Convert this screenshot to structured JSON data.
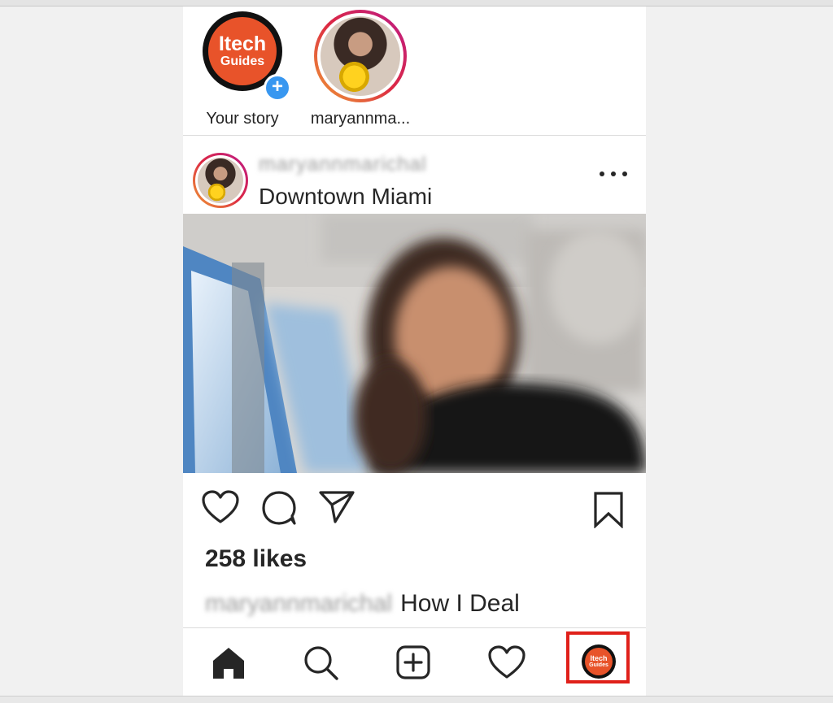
{
  "stories": [
    {
      "label": "Your story",
      "logo_line1": "Itech",
      "logo_line2": "Guides",
      "badge": "+"
    },
    {
      "label": "maryannma..."
    }
  ],
  "post": {
    "username": "maryannmarichal",
    "location": "Downtown Miami",
    "more": "...",
    "likes": "258 likes",
    "caption_username": "maryannmarichal",
    "caption_text": "How I Deal"
  },
  "tabbar": {
    "items": [
      "home-icon",
      "search-icon",
      "add-post-icon",
      "activity-icon",
      "profile-icon"
    ],
    "profile_line1": "Itech",
    "profile_line2": "Guides",
    "highlight_color": "#e0201a"
  },
  "colors": {
    "logo_orange": "#e8532a",
    "badge_blue": "#3897f0",
    "text": "#262626"
  }
}
